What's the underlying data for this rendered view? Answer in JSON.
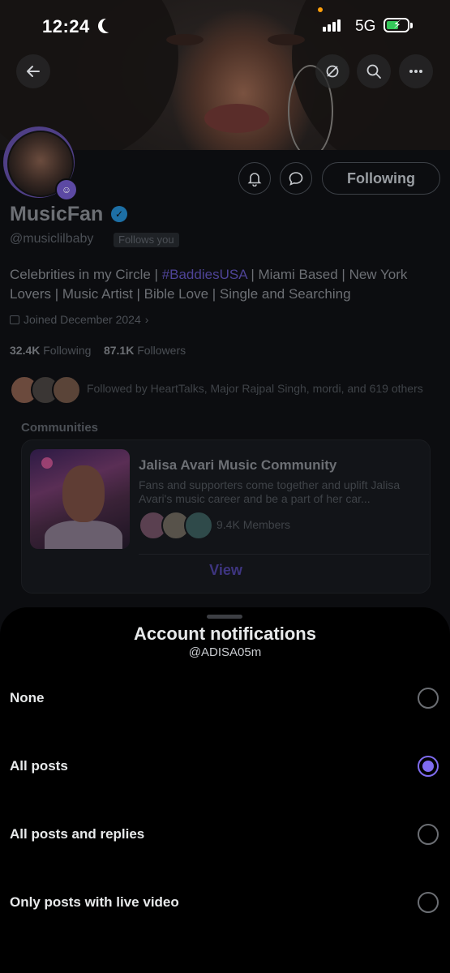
{
  "status_bar": {
    "time": "12:24",
    "network": "5G"
  },
  "profile": {
    "name": "MusicFan",
    "handle": "@musiclilbaby",
    "follows_you": "Follows you",
    "following_button": "Following",
    "bio_part1": "Celebrities in my Circle | ",
    "bio_hashtag": "#BaddiesUSA",
    "bio_part2": " | Miami Based | New York Lovers | Music Artist | Bible Love | Single and Searching",
    "joined": "Joined December 2024",
    "following_count": "32.4K",
    "following_label": "Following",
    "followers_count": "87.1K",
    "followers_label": "Followers",
    "followed_by": "Followed by HeartTalks, Major Rajpal Singh, mordi, and 619 others"
  },
  "communities": {
    "label": "Communities",
    "title": "Jalisa Avari Music Community",
    "description": "Fans and supporters come together and uplift Jalisa Avari's music career and be a part of her car...",
    "members": "9.4K Members",
    "view_label": "View"
  },
  "sheet": {
    "title": "Account notifications",
    "subtitle": "@ADISA05m",
    "options": [
      {
        "label": "None",
        "selected": false
      },
      {
        "label": "All posts",
        "selected": true
      },
      {
        "label": "All posts and replies",
        "selected": false
      },
      {
        "label": "Only posts with live video",
        "selected": false
      }
    ]
  },
  "colors": {
    "accent": "#7f6cf0",
    "verified": "#1d9bf0",
    "sheet_bg": "#000000"
  }
}
